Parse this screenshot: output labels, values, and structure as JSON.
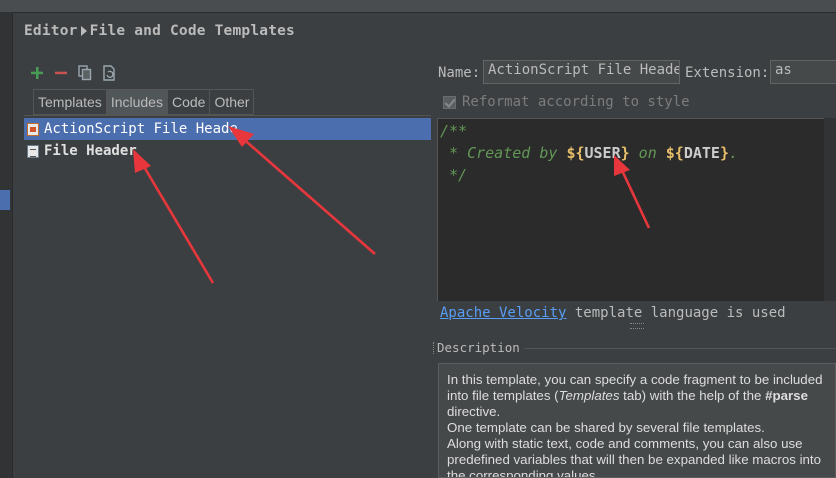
{
  "breadcrumb": {
    "part1": "Editor",
    "part2": "File and Code Templates"
  },
  "toolbar": {
    "buttons": [
      {
        "name": "add",
        "icon": "plus-icon",
        "color": "#499c54"
      },
      {
        "name": "remove",
        "icon": "minus-icon",
        "color": "#c75450"
      },
      {
        "name": "copy",
        "icon": "copy-icon"
      },
      {
        "name": "reset",
        "icon": "reset-icon"
      }
    ]
  },
  "tabs": [
    {
      "label": "Templates",
      "active": false
    },
    {
      "label": "Includes",
      "active": true
    },
    {
      "label": "Code",
      "active": false
    },
    {
      "label": "Other",
      "active": false
    }
  ],
  "templates": [
    {
      "label": "ActionScript File Heade",
      "icon": "actionscript-file-icon",
      "selected": true
    },
    {
      "label": "File Header",
      "icon": "file-icon",
      "selected": false
    }
  ],
  "form": {
    "name_label": "Name:",
    "name_value": "ActionScript File Heade",
    "extension_label": "Extension:",
    "extension_value": "as",
    "reformat_label": "Reformat according to style",
    "reformat_checked": true
  },
  "editor": {
    "line1": "/**",
    "line2_prefix": " * Created by ",
    "var_user": "USER",
    "line2_mid": " on ",
    "var_date": "DATE",
    "line2_suffix": ".",
    "line3": " */"
  },
  "velocity": {
    "link": "Apache Velocity",
    "rest": "template language is used"
  },
  "description": {
    "header": "Description",
    "p1_a": "In this template, you can specify a code fragment to be included into file templates (",
    "p1_em": "Templates",
    "p1_b": " tab) with the help of the ",
    "p1_strong": "#parse",
    "p1_c": " directive.",
    "p2": "One template can be shared by several file templates.",
    "p3": "Along with static text, code and comments, you can also use predefined variables that will then be expanded like macros into the corresponding values."
  },
  "colors": {
    "accent": "#4b6eaf",
    "annotation_arrow": "#e8373c",
    "comment": "#629755",
    "variable": "#e8bf6a",
    "link": "#589df6"
  }
}
